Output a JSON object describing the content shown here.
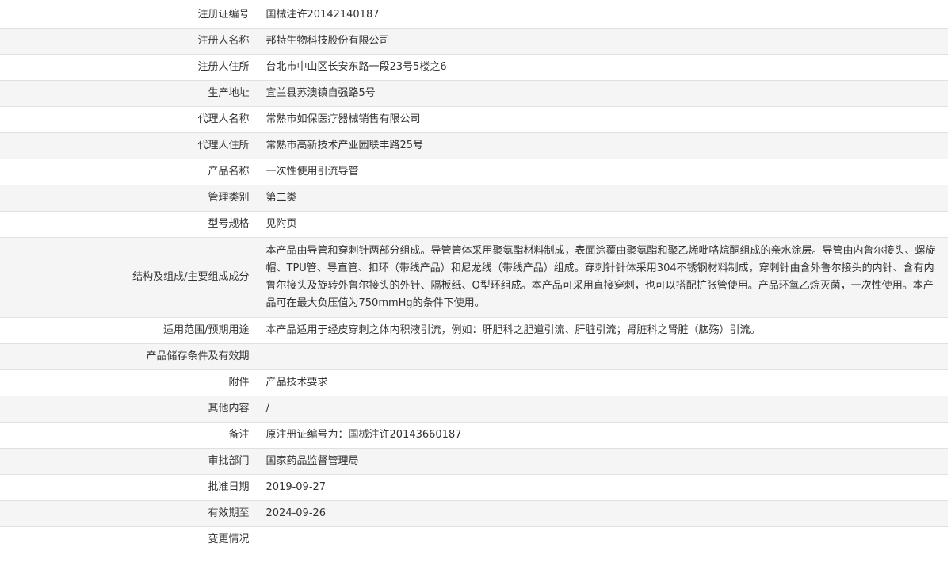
{
  "rows": [
    {
      "label": "注册证编号",
      "value": "国械注许20142140187"
    },
    {
      "label": "注册人名称",
      "value": "邦特生物科技股份有限公司"
    },
    {
      "label": "注册人住所",
      "value": "台北市中山区长安东路一段23号5楼之6"
    },
    {
      "label": "生产地址",
      "value": "宜兰县苏澳镇自强路5号"
    },
    {
      "label": "代理人名称",
      "value": "常熟市如保医疗器械销售有限公司"
    },
    {
      "label": "代理人住所",
      "value": "常熟市高新技术产业园联丰路25号"
    },
    {
      "label": "产品名称",
      "value": "一次性使用引流导管"
    },
    {
      "label": "管理类别",
      "value": "第二类"
    },
    {
      "label": "型号规格",
      "value": "见附页"
    },
    {
      "label": "结构及组成/主要组成成分",
      "value": "本产品由导管和穿刺针两部分组成。导管管体采用聚氨酯材料制成，表面涂覆由聚氨酯和聚乙烯吡咯烷酮组成的亲水涂层。导管由内鲁尔接头、螺旋帽、TPU管、导直管、扣环（带线产品）和尼龙线（带线产品）组成。穿刺针针体采用304不锈钢材料制成，穿刺针由含外鲁尔接头的内针、含有内鲁尔接头及旋转外鲁尔接头的外针、隔板纸、O型环组成。本产品可采用直接穿刺，也可以搭配扩张管使用。产品环氧乙烷灭菌，一次性使用。本产品可在最大负压值为750mmHg的条件下使用。"
    },
    {
      "label": "适用范围/预期用途",
      "value": "本产品适用于经皮穿刺之体内积液引流，例如：肝胆科之胆道引流、肝脏引流；肾脏科之肾脏（肱殇）引流。"
    },
    {
      "label": "产品储存条件及有效期",
      "value": ""
    },
    {
      "label": "附件",
      "value": "产品技术要求"
    },
    {
      "label": "其他内容",
      "value": "/"
    },
    {
      "label": "备注",
      "value": "原注册证编号为：国械注许20143660187"
    },
    {
      "label": "审批部门",
      "value": "国家药品监督管理局"
    },
    {
      "label": "批准日期",
      "value": "2019-09-27"
    },
    {
      "label": "有效期至",
      "value": "2024-09-26"
    },
    {
      "label": "变更情况",
      "value": ""
    }
  ]
}
